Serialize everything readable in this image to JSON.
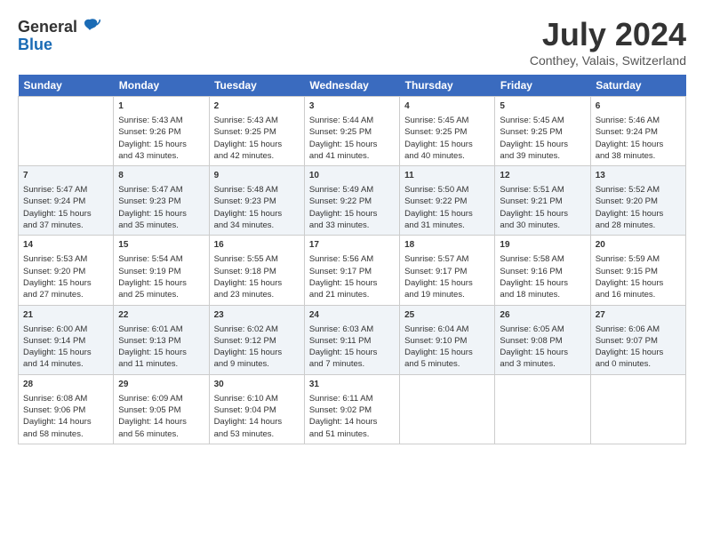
{
  "header": {
    "logo_line1": "General",
    "logo_line2": "Blue",
    "title": "July 2024",
    "subtitle": "Conthey, Valais, Switzerland"
  },
  "table": {
    "headers": [
      "Sunday",
      "Monday",
      "Tuesday",
      "Wednesday",
      "Thursday",
      "Friday",
      "Saturday"
    ],
    "rows": [
      [
        {
          "day": "",
          "lines": []
        },
        {
          "day": "1",
          "lines": [
            "Sunrise: 5:43 AM",
            "Sunset: 9:26 PM",
            "Daylight: 15 hours",
            "and 43 minutes."
          ]
        },
        {
          "day": "2",
          "lines": [
            "Sunrise: 5:43 AM",
            "Sunset: 9:25 PM",
            "Daylight: 15 hours",
            "and 42 minutes."
          ]
        },
        {
          "day": "3",
          "lines": [
            "Sunrise: 5:44 AM",
            "Sunset: 9:25 PM",
            "Daylight: 15 hours",
            "and 41 minutes."
          ]
        },
        {
          "day": "4",
          "lines": [
            "Sunrise: 5:45 AM",
            "Sunset: 9:25 PM",
            "Daylight: 15 hours",
            "and 40 minutes."
          ]
        },
        {
          "day": "5",
          "lines": [
            "Sunrise: 5:45 AM",
            "Sunset: 9:25 PM",
            "Daylight: 15 hours",
            "and 39 minutes."
          ]
        },
        {
          "day": "6",
          "lines": [
            "Sunrise: 5:46 AM",
            "Sunset: 9:24 PM",
            "Daylight: 15 hours",
            "and 38 minutes."
          ]
        }
      ],
      [
        {
          "day": "7",
          "lines": [
            "Sunrise: 5:47 AM",
            "Sunset: 9:24 PM",
            "Daylight: 15 hours",
            "and 37 minutes."
          ]
        },
        {
          "day": "8",
          "lines": [
            "Sunrise: 5:47 AM",
            "Sunset: 9:23 PM",
            "Daylight: 15 hours",
            "and 35 minutes."
          ]
        },
        {
          "day": "9",
          "lines": [
            "Sunrise: 5:48 AM",
            "Sunset: 9:23 PM",
            "Daylight: 15 hours",
            "and 34 minutes."
          ]
        },
        {
          "day": "10",
          "lines": [
            "Sunrise: 5:49 AM",
            "Sunset: 9:22 PM",
            "Daylight: 15 hours",
            "and 33 minutes."
          ]
        },
        {
          "day": "11",
          "lines": [
            "Sunrise: 5:50 AM",
            "Sunset: 9:22 PM",
            "Daylight: 15 hours",
            "and 31 minutes."
          ]
        },
        {
          "day": "12",
          "lines": [
            "Sunrise: 5:51 AM",
            "Sunset: 9:21 PM",
            "Daylight: 15 hours",
            "and 30 minutes."
          ]
        },
        {
          "day": "13",
          "lines": [
            "Sunrise: 5:52 AM",
            "Sunset: 9:20 PM",
            "Daylight: 15 hours",
            "and 28 minutes."
          ]
        }
      ],
      [
        {
          "day": "14",
          "lines": [
            "Sunrise: 5:53 AM",
            "Sunset: 9:20 PM",
            "Daylight: 15 hours",
            "and 27 minutes."
          ]
        },
        {
          "day": "15",
          "lines": [
            "Sunrise: 5:54 AM",
            "Sunset: 9:19 PM",
            "Daylight: 15 hours",
            "and 25 minutes."
          ]
        },
        {
          "day": "16",
          "lines": [
            "Sunrise: 5:55 AM",
            "Sunset: 9:18 PM",
            "Daylight: 15 hours",
            "and 23 minutes."
          ]
        },
        {
          "day": "17",
          "lines": [
            "Sunrise: 5:56 AM",
            "Sunset: 9:17 PM",
            "Daylight: 15 hours",
            "and 21 minutes."
          ]
        },
        {
          "day": "18",
          "lines": [
            "Sunrise: 5:57 AM",
            "Sunset: 9:17 PM",
            "Daylight: 15 hours",
            "and 19 minutes."
          ]
        },
        {
          "day": "19",
          "lines": [
            "Sunrise: 5:58 AM",
            "Sunset: 9:16 PM",
            "Daylight: 15 hours",
            "and 18 minutes."
          ]
        },
        {
          "day": "20",
          "lines": [
            "Sunrise: 5:59 AM",
            "Sunset: 9:15 PM",
            "Daylight: 15 hours",
            "and 16 minutes."
          ]
        }
      ],
      [
        {
          "day": "21",
          "lines": [
            "Sunrise: 6:00 AM",
            "Sunset: 9:14 PM",
            "Daylight: 15 hours",
            "and 14 minutes."
          ]
        },
        {
          "day": "22",
          "lines": [
            "Sunrise: 6:01 AM",
            "Sunset: 9:13 PM",
            "Daylight: 15 hours",
            "and 11 minutes."
          ]
        },
        {
          "day": "23",
          "lines": [
            "Sunrise: 6:02 AM",
            "Sunset: 9:12 PM",
            "Daylight: 15 hours",
            "and 9 minutes."
          ]
        },
        {
          "day": "24",
          "lines": [
            "Sunrise: 6:03 AM",
            "Sunset: 9:11 PM",
            "Daylight: 15 hours",
            "and 7 minutes."
          ]
        },
        {
          "day": "25",
          "lines": [
            "Sunrise: 6:04 AM",
            "Sunset: 9:10 PM",
            "Daylight: 15 hours",
            "and 5 minutes."
          ]
        },
        {
          "day": "26",
          "lines": [
            "Sunrise: 6:05 AM",
            "Sunset: 9:08 PM",
            "Daylight: 15 hours",
            "and 3 minutes."
          ]
        },
        {
          "day": "27",
          "lines": [
            "Sunrise: 6:06 AM",
            "Sunset: 9:07 PM",
            "Daylight: 15 hours",
            "and 0 minutes."
          ]
        }
      ],
      [
        {
          "day": "28",
          "lines": [
            "Sunrise: 6:08 AM",
            "Sunset: 9:06 PM",
            "Daylight: 14 hours",
            "and 58 minutes."
          ]
        },
        {
          "day": "29",
          "lines": [
            "Sunrise: 6:09 AM",
            "Sunset: 9:05 PM",
            "Daylight: 14 hours",
            "and 56 minutes."
          ]
        },
        {
          "day": "30",
          "lines": [
            "Sunrise: 6:10 AM",
            "Sunset: 9:04 PM",
            "Daylight: 14 hours",
            "and 53 minutes."
          ]
        },
        {
          "day": "31",
          "lines": [
            "Sunrise: 6:11 AM",
            "Sunset: 9:02 PM",
            "Daylight: 14 hours",
            "and 51 minutes."
          ]
        },
        {
          "day": "",
          "lines": []
        },
        {
          "day": "",
          "lines": []
        },
        {
          "day": "",
          "lines": []
        }
      ]
    ]
  }
}
